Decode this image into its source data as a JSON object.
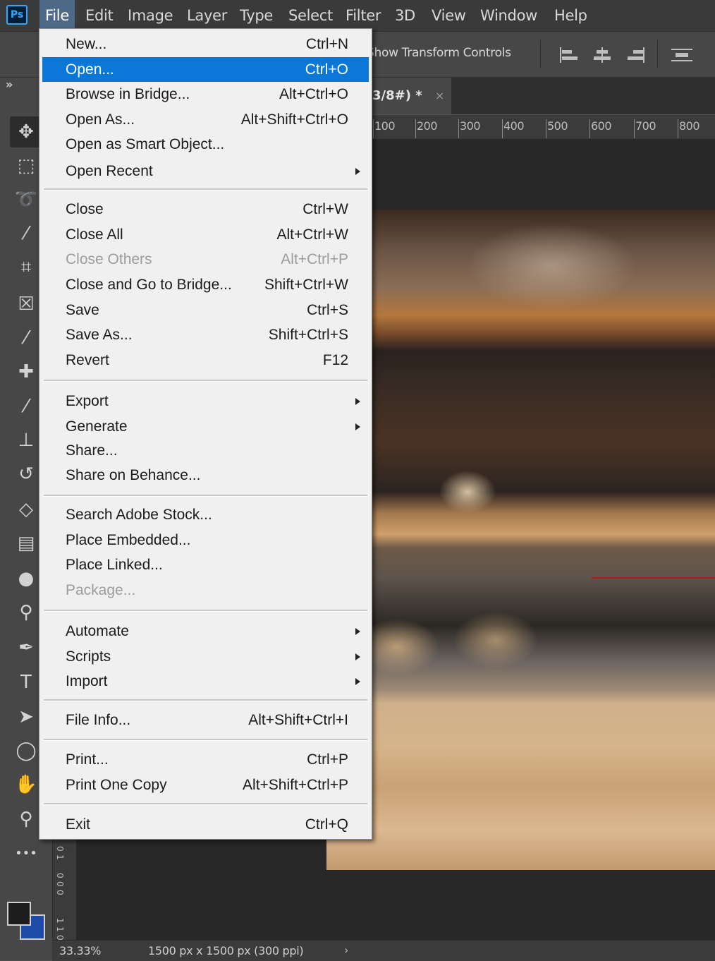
{
  "menubar": {
    "logo": "Ps",
    "items": [
      "File",
      "Edit",
      "Image",
      "Layer",
      "Type",
      "Select",
      "Filter",
      "3D",
      "View",
      "Window",
      "Help"
    ],
    "active": "File"
  },
  "options_bar": {
    "show_transform_controls": "Show Transform Controls"
  },
  "document_tab": {
    "title": "3/8#) *",
    "close": "×"
  },
  "ruler": {
    "top_labels": [
      "100",
      "200",
      "300",
      "400",
      "500",
      "600",
      "700",
      "800"
    ],
    "left_labels": [
      "0",
      "1",
      "0",
      "0",
      "0",
      "1",
      "1",
      "0"
    ]
  },
  "file_menu": {
    "items": [
      {
        "label": "New...",
        "shortcut": "Ctrl+N"
      },
      {
        "label": "Open...",
        "shortcut": "Ctrl+O",
        "highlighted": true
      },
      {
        "label": "Browse in Bridge...",
        "shortcut": "Alt+Ctrl+O"
      },
      {
        "label": "Open As...",
        "shortcut": "Alt+Shift+Ctrl+O"
      },
      {
        "label": "Open as Smart Object...",
        "shortcut": ""
      },
      {
        "label": "Open Recent",
        "shortcut": "",
        "submenu": true
      },
      {
        "label": "Close",
        "shortcut": "Ctrl+W"
      },
      {
        "label": "Close All",
        "shortcut": "Alt+Ctrl+W"
      },
      {
        "label": "Close Others",
        "shortcut": "Alt+Ctrl+P",
        "disabled": true
      },
      {
        "label": "Close and Go to Bridge...",
        "shortcut": "Shift+Ctrl+W"
      },
      {
        "label": "Save",
        "shortcut": "Ctrl+S"
      },
      {
        "label": "Save As...",
        "shortcut": "Shift+Ctrl+S"
      },
      {
        "label": "Revert",
        "shortcut": "F12"
      },
      {
        "label": "Export",
        "shortcut": "",
        "submenu": true
      },
      {
        "label": "Generate",
        "shortcut": "",
        "submenu": true
      },
      {
        "label": "Share...",
        "shortcut": ""
      },
      {
        "label": "Share on Behance...",
        "shortcut": ""
      },
      {
        "label": "Search Adobe Stock...",
        "shortcut": ""
      },
      {
        "label": "Place Embedded...",
        "shortcut": ""
      },
      {
        "label": "Place Linked...",
        "shortcut": ""
      },
      {
        "label": "Package...",
        "shortcut": "",
        "disabled": true
      },
      {
        "label": "Automate",
        "shortcut": "",
        "submenu": true
      },
      {
        "label": "Scripts",
        "shortcut": "",
        "submenu": true
      },
      {
        "label": "Import",
        "shortcut": "",
        "submenu": true
      },
      {
        "label": "File Info...",
        "shortcut": "Alt+Shift+Ctrl+I"
      },
      {
        "label": "Print...",
        "shortcut": "Ctrl+P"
      },
      {
        "label": "Print One Copy",
        "shortcut": "Alt+Shift+Ctrl+P"
      },
      {
        "label": "Exit",
        "shortcut": "Ctrl+Q"
      }
    ]
  },
  "toolbar": {
    "collapse": "»",
    "tools": [
      {
        "name": "move-tool",
        "glyph": "✥"
      },
      {
        "name": "marquee-tool",
        "glyph": "⬚"
      },
      {
        "name": "lasso-tool",
        "glyph": "➰"
      },
      {
        "name": "magic-wand-tool",
        "glyph": "⁄"
      },
      {
        "name": "crop-tool",
        "glyph": "⌗"
      },
      {
        "name": "frame-tool",
        "glyph": "☒"
      },
      {
        "name": "eyedropper-tool",
        "glyph": "⁄"
      },
      {
        "name": "healing-tool",
        "glyph": "✚"
      },
      {
        "name": "brush-tool",
        "glyph": "⁄"
      },
      {
        "name": "stamp-tool",
        "glyph": "⊥"
      },
      {
        "name": "history-brush-tool",
        "glyph": "↺"
      },
      {
        "name": "eraser-tool",
        "glyph": "◇"
      },
      {
        "name": "gradient-tool",
        "glyph": "▤"
      },
      {
        "name": "blur-tool",
        "glyph": "●"
      },
      {
        "name": "dodge-tool",
        "glyph": "⚲"
      },
      {
        "name": "pen-tool",
        "glyph": "✒"
      },
      {
        "name": "type-tool",
        "glyph": "T"
      },
      {
        "name": "path-selection-tool",
        "glyph": "➤"
      },
      {
        "name": "ellipse-tool",
        "glyph": "◯"
      },
      {
        "name": "hand-tool",
        "glyph": "✋"
      },
      {
        "name": "zoom-tool",
        "glyph": "⚲"
      },
      {
        "name": "edit-toolbar",
        "glyph": "•••"
      }
    ]
  },
  "status": {
    "zoom": "33.33%",
    "doc_size": "1500 px x 1500 px (300 ppi)",
    "arrow": "›"
  },
  "colors": {
    "menu_highlight": "#0b78d7",
    "guide": "#b01818",
    "background_swatch": "#1f4aa8",
    "foreground_swatch": "#1d1d1d"
  }
}
